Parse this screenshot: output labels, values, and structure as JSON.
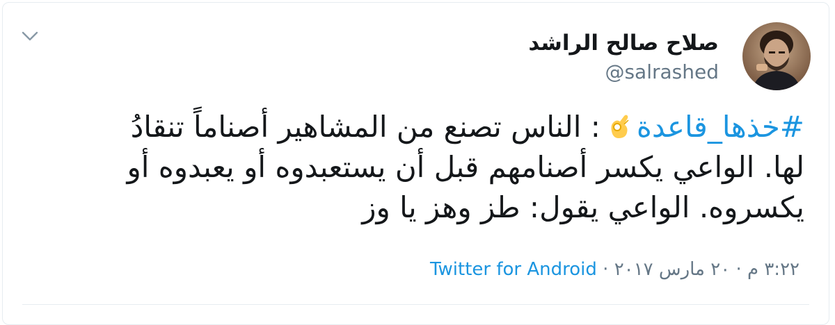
{
  "tweet": {
    "author_name": "صلاح صالح الراشد",
    "author_handle": "@salrashed",
    "avatar_icon": "avatar-photo",
    "more_menu_icon": "chevron-down-icon",
    "hashtag": "#خذها_قاعدة",
    "emoji_icon": "ok-hand-emoji-icon",
    "text_line1_rest": ": الناس تصنع من المشاهير أصناماً تنقادُ",
    "text_line2": "لها. الواعي يكسر أصنامهم قبل أن يستعبدوه أو يعبدوه أو",
    "text_line3": "يكسروه. الواعي يقول: طز وهز يا وز",
    "timestamp": "٣:٢٢ م · ٢٠ مارس ٢٠١٧",
    "meta_separator": " · ",
    "source": "Twitter for Android"
  },
  "colors": {
    "link": "#1b95e0",
    "secondary_text": "#657786",
    "primary_text": "#14171a",
    "border": "#e6ecf0"
  }
}
